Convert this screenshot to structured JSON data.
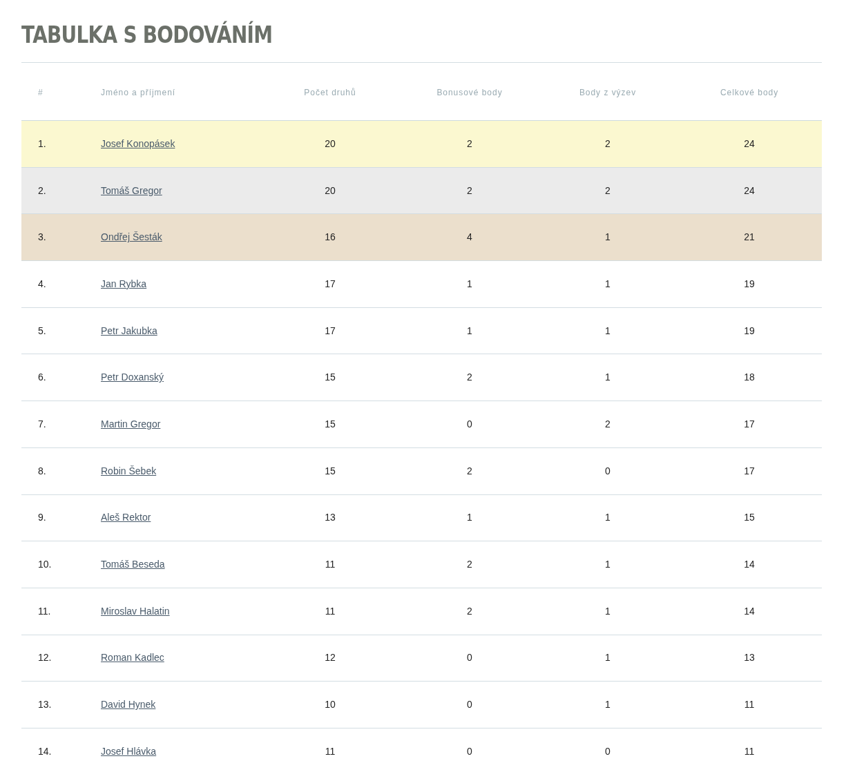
{
  "title": "TABULKA S BODOVÁNÍM",
  "table": {
    "columns": [
      "#",
      "Jméno a příjmení",
      "Počet druhů",
      "Bonusové body",
      "Body z výzev",
      "Celkové body"
    ],
    "rows": [
      {
        "rank": "1.",
        "name": "Josef Konopásek",
        "species": "20",
        "bonus": "2",
        "challenges": "2",
        "total": "24",
        "color": "#fbf8d0"
      },
      {
        "rank": "2.",
        "name": "Tomáš Gregor",
        "species": "20",
        "bonus": "2",
        "challenges": "2",
        "total": "24",
        "color": "#ebebeb"
      },
      {
        "rank": "3.",
        "name": "Ondřej Šesták",
        "species": "16",
        "bonus": "4",
        "challenges": "1",
        "total": "21",
        "color": "#ebdfcc"
      },
      {
        "rank": "4.",
        "name": "Jan Rybka",
        "species": "17",
        "bonus": "1",
        "challenges": "1",
        "total": "19"
      },
      {
        "rank": "5.",
        "name": "Petr Jakubka",
        "species": "17",
        "bonus": "1",
        "challenges": "1",
        "total": "19"
      },
      {
        "rank": "6.",
        "name": "Petr Doxanský",
        "species": "15",
        "bonus": "2",
        "challenges": "1",
        "total": "18"
      },
      {
        "rank": "7.",
        "name": "Martin Gregor",
        "species": "15",
        "bonus": "0",
        "challenges": "2",
        "total": "17"
      },
      {
        "rank": "8.",
        "name": "Robin Šebek",
        "species": "15",
        "bonus": "2",
        "challenges": "0",
        "total": "17"
      },
      {
        "rank": "9.",
        "name": "Aleš Rektor",
        "species": "13",
        "bonus": "1",
        "challenges": "1",
        "total": "15"
      },
      {
        "rank": "10.",
        "name": "Tomáš Beseda",
        "species": "11",
        "bonus": "2",
        "challenges": "1",
        "total": "14"
      },
      {
        "rank": "11.",
        "name": "Miroslav Halatin",
        "species": "11",
        "bonus": "2",
        "challenges": "1",
        "total": "14"
      },
      {
        "rank": "12.",
        "name": "Roman Kadlec",
        "species": "12",
        "bonus": "0",
        "challenges": "1",
        "total": "13"
      },
      {
        "rank": "13.",
        "name": "David Hynek",
        "species": "10",
        "bonus": "0",
        "challenges": "1",
        "total": "11"
      },
      {
        "rank": "14.",
        "name": "Josef Hlávka",
        "species": "11",
        "bonus": "0",
        "challenges": "0",
        "total": "11"
      }
    ]
  }
}
